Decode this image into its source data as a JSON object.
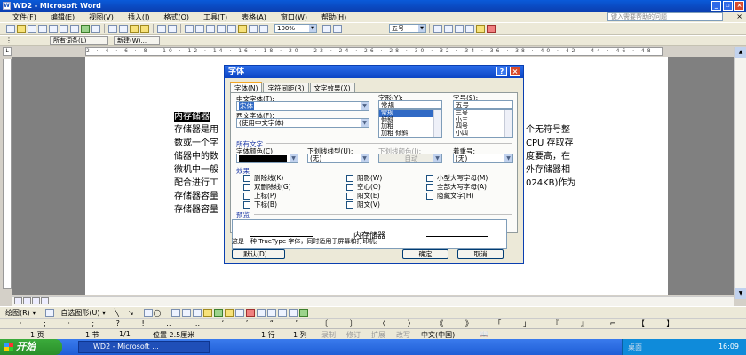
{
  "window": {
    "title": "WD2 - Microsoft Word"
  },
  "menu": {
    "items": [
      "文件(F)",
      "编辑(E)",
      "视图(V)",
      "插入(I)",
      "格式(O)",
      "工具(T)",
      "表格(A)",
      "窗口(W)",
      "帮助(H)"
    ],
    "help_placeholder": "键入需要帮助的问题",
    "close_symbol": "×"
  },
  "toolbar": {
    "zoom": "100%",
    "font_size": "五号",
    "style_label": "所有词条(L)",
    "new_label": "新建(W)..."
  },
  "ruler": {
    "numbers": "2 · 4 · 6 · 8 · 10 · 12 · 14 · 16 · 18 · 20 · 22 · 24 · 26 · 28 · 30 · 32 · 34 · 36 · 38 · 40 · 42 · 44 · 46 · 48",
    "corner": "L"
  },
  "document": {
    "selected": "内存储器",
    "left_lines": [
      "存储器是用",
      "数或一个字",
      "储器中的数",
      "微机中一般",
      "配合进行工",
      "存储器容量",
      "存储器容量"
    ],
    "right_lines": [
      "个无符号整",
      "CPU 存取存",
      "度要高，在",
      "外存储器相",
      "",
      "024KB)作为",
      ""
    ]
  },
  "dialog": {
    "title": "字体",
    "help_btn": "?",
    "close_btn": "×",
    "tabs": [
      "字体(N)",
      "字符间距(R)",
      "文字效果(X)"
    ],
    "cn_font_label": "中文字体(T):",
    "cn_font_value": "宋体",
    "western_font_label": "西文字体(F):",
    "western_font_value": "(使用中文字体)",
    "style_label": "字形(Y):",
    "style_value": "常规",
    "style_options": [
      "常规",
      "倾斜",
      "加粗",
      "加粗 倾斜"
    ],
    "size_label": "字号(S):",
    "size_value": "五号",
    "size_options": [
      "三号",
      "小三",
      "四号",
      "小四",
      "五号"
    ],
    "all_text_title": "所有文字",
    "color_label": "字体颜色(C):",
    "underline_label": "下划线线型(U):",
    "underline_value": "(无)",
    "ul_color_label": "下划线颜色(I):",
    "ul_color_value": "自动",
    "emphasis_label": "着重号:",
    "emphasis_value": "(无)",
    "effects_title": "效果",
    "effects_col1": [
      "删除线(K)",
      "双删除线(G)",
      "上标(P)",
      "下标(B)"
    ],
    "effects_col2": [
      "阴影(W)",
      "空心(O)",
      "阳文(E)",
      "阴文(V)"
    ],
    "effects_col3": [
      "小型大写字母(M)",
      "全部大写字母(A)",
      "隐藏文字(H)"
    ],
    "preview_title": "预览",
    "preview_text": "内存储器",
    "truetype_note": "这是一种 TrueType 字体，同时适用于屏幕和打印机。",
    "default_btn": "默认(D)...",
    "ok_btn": "确定",
    "cancel_btn": "取消"
  },
  "drawing": {
    "draw_label": "绘图(R) ▾",
    "autoshape_label": "自选图形(U) ▾"
  },
  "shortcuts": "· ; · ; ? ! ‥ … ‘ ’ “ ” 〔 〕 〈 〉 《 》 「 」 『 』 ⌐ 【 】",
  "status": {
    "page": "1 页",
    "section": "1 节",
    "page_of": "1/1",
    "position": "位置 2.5厘米",
    "line": "1 行",
    "column": "1 列",
    "rec": "录制",
    "trk": "修订",
    "ext": "扩展",
    "ovr": "改写",
    "lang": "中文(中国)"
  },
  "taskbar": {
    "start": "开始",
    "task": "WD2 - Microsoft ...",
    "desktop": "桌面",
    "clock": "16:09"
  }
}
